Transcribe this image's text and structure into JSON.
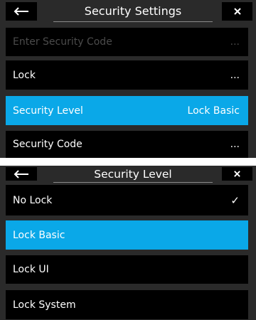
{
  "security_settings": {
    "title": "Security Settings",
    "items": [
      {
        "label": "Enter Security Code",
        "value": "..."
      },
      {
        "label": "Lock",
        "value": "..."
      },
      {
        "label": "Security Level",
        "value": "Lock Basic"
      },
      {
        "label": "Security Code",
        "value": "..."
      }
    ]
  },
  "security_level": {
    "title": "Security Level",
    "items": [
      {
        "label": "No Lock",
        "check": "✓"
      },
      {
        "label": "Lock Basic"
      },
      {
        "label": "Lock UI"
      },
      {
        "label": "Lock System"
      }
    ]
  },
  "icons": {
    "back": "back-arrow-icon",
    "close": "close-icon",
    "check": "check-icon"
  },
  "colors": {
    "selected": "#0aa8e8",
    "row_bg": "#000000",
    "panel_bg": "#2a2a2a",
    "disabled_text": "#4b4b4b"
  }
}
